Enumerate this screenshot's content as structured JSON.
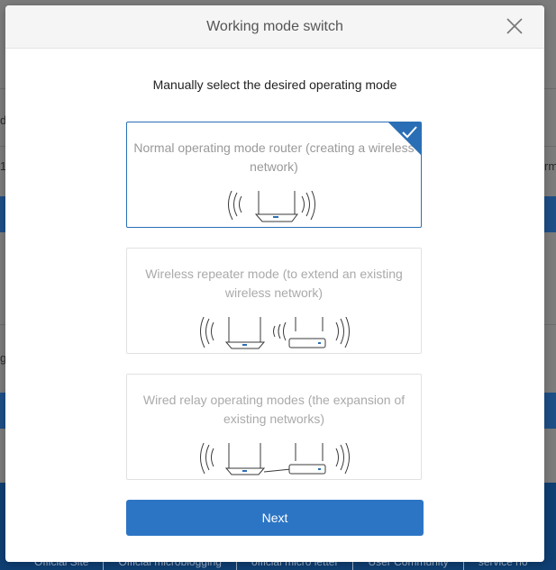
{
  "modal": {
    "title": "Working mode switch",
    "subtitle": "Manually select the desired operating mode",
    "next_label": "Next"
  },
  "modes": [
    {
      "label": "Normal operating mode router (creating a wireless network)",
      "selected": true
    },
    {
      "label": "Wireless repeater mode (to extend an existing wireless network)",
      "selected": false
    },
    {
      "label": "Wired relay operating modes (the expansion of existing networks)",
      "selected": false
    }
  ],
  "background": {
    "fragments": [
      "d",
      "1",
      "rm",
      "g"
    ],
    "footer_links": [
      "Official Site",
      "Official microblogging",
      "official micro letter",
      "User Community",
      "service ho"
    ]
  },
  "colors": {
    "accent": "#2c75c4",
    "selected_border": "#2a6fb6"
  },
  "icons": [
    "close-icon",
    "checkmark-icon",
    "router-icon",
    "signal-wave-icon",
    "repeater-icon",
    "cable-icon"
  ]
}
